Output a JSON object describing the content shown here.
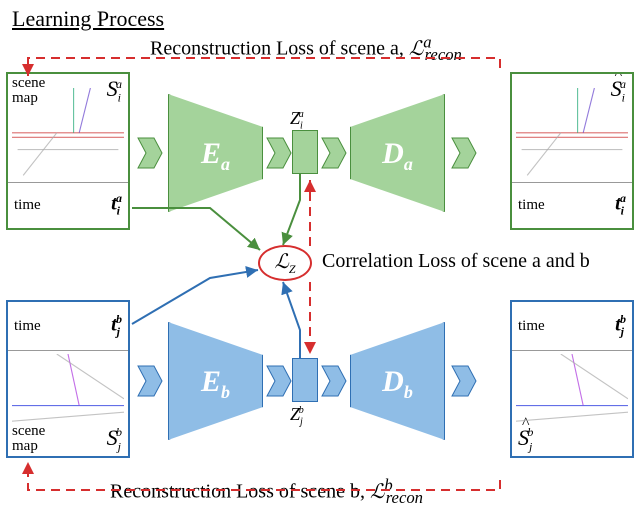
{
  "title": "Learning Process",
  "loss_a_text": "Reconstruction Loss of scene a, ",
  "loss_a_sym": "ℒ",
  "loss_a_sup": "a",
  "loss_a_sub": "recon",
  "loss_b_text": "Reconstruction Loss of scene b, ",
  "loss_b_sym": "ℒ",
  "loss_b_sup": "b",
  "loss_b_sub": "recon",
  "corr_text": "Correlation Loss of scene a and b",
  "lz_sym": "ℒ",
  "lz_sub": "Z",
  "scene_map_label": "scene\nmap",
  "time_label": "time",
  "row_a": {
    "input_sym": "S",
    "input_sub": "i",
    "input_sup": "a",
    "time_sym": "t",
    "time_sub": "i",
    "time_sup": "a",
    "encoder": "E",
    "encoder_sub": "a",
    "latent": "Z",
    "latent_sub": "i",
    "latent_sup": "a",
    "decoder": "D",
    "decoder_sub": "a",
    "output_sym": "Ŝ",
    "output_sub": "i",
    "output_sup": "a"
  },
  "row_b": {
    "input_sym": "S",
    "input_sub": "j",
    "input_sup": "b",
    "time_sym": "t",
    "time_sub": "j",
    "time_sup": "b",
    "encoder": "E",
    "encoder_sub": "b",
    "latent": "Z",
    "latent_sub": "j",
    "latent_sup": "b",
    "decoder": "D",
    "decoder_sub": "b",
    "output_sym": "Ŝ",
    "output_sub": "j",
    "output_sup": "b"
  }
}
